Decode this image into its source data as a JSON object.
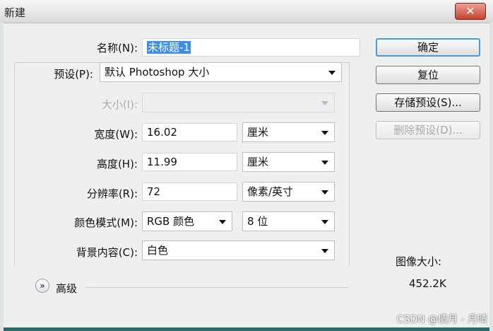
{
  "window": {
    "title": "新建",
    "close_icon": "close-icon"
  },
  "form": {
    "name": {
      "label": "名称(N):",
      "value": "未标题-1"
    },
    "preset": {
      "label": "预设(P):",
      "value": "默认 Photoshop 大小"
    },
    "size": {
      "label": "大小(I):",
      "value": ""
    },
    "width": {
      "label": "宽度(W):",
      "value": "16.02",
      "unit": "厘米"
    },
    "height": {
      "label": "高度(H):",
      "value": "11.99",
      "unit": "厘米"
    },
    "resolution": {
      "label": "分辨率(R):",
      "value": "72",
      "unit": "像素/英寸"
    },
    "color_mode": {
      "label": "颜色模式(M):",
      "value": "RGB 颜色",
      "depth": "8 位"
    },
    "background": {
      "label": "背景内容(C):",
      "value": "白色"
    },
    "advanced": {
      "label": "高级",
      "icon": "double-chevron-down-icon"
    }
  },
  "buttons": {
    "ok": "确定",
    "reset": "复位",
    "save_preset": "存储预设(S)...",
    "delete_preset": "删除预设(D)..."
  },
  "image_size": {
    "label": "图像大小:",
    "value": "452.2K"
  },
  "watermark": "CSDN @情月 - 月晴",
  "colors": {
    "accent": "#3d8ee8",
    "default_button_border": "#4c9bd3",
    "close_button": "#c7432f"
  }
}
